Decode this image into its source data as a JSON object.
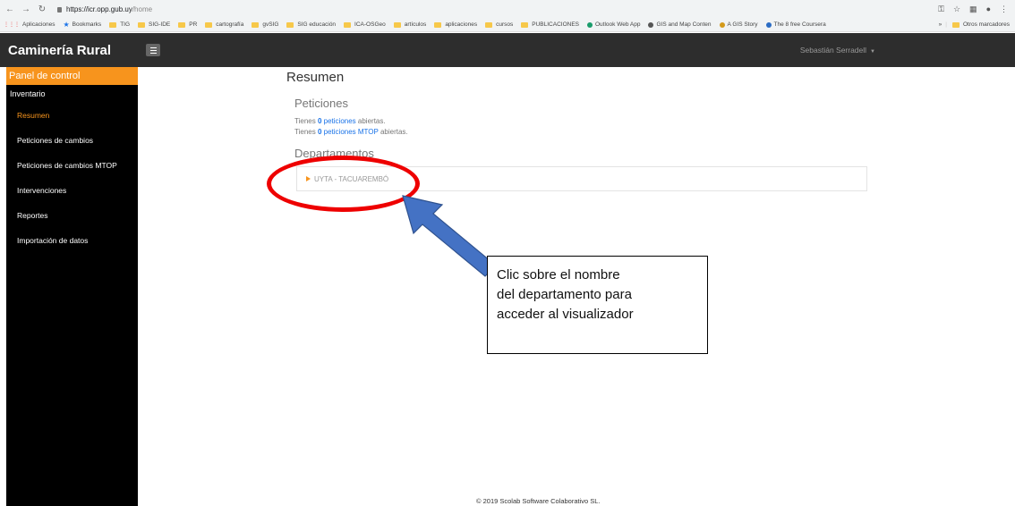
{
  "browser": {
    "url_host": "https://icr.opp.gub.uy",
    "url_path": "/home",
    "bookmarks": [
      {
        "label": "Aplicaciones",
        "kind": "apps"
      },
      {
        "label": "Bookmarks",
        "kind": "star"
      },
      {
        "label": "TIG",
        "kind": "folder"
      },
      {
        "label": "SIG-IDE",
        "kind": "folder"
      },
      {
        "label": "PR",
        "kind": "folder"
      },
      {
        "label": "cartografía",
        "kind": "folder"
      },
      {
        "label": "gvSIG",
        "kind": "folder"
      },
      {
        "label": "SIG educación",
        "kind": "folder"
      },
      {
        "label": "ICA-OSGeo",
        "kind": "folder"
      },
      {
        "label": "artículos",
        "kind": "folder"
      },
      {
        "label": "aplicaciones",
        "kind": "folder"
      },
      {
        "label": "cursos",
        "kind": "folder"
      },
      {
        "label": "PUBLICACIONES",
        "kind": "folder"
      },
      {
        "label": "Outlook Web App",
        "kind": "site"
      },
      {
        "label": "GIS and Map Conten",
        "kind": "site"
      },
      {
        "label": "A GIS Story",
        "kind": "site"
      },
      {
        "label": "The 8 free Coursera",
        "kind": "site"
      }
    ],
    "other_bookmarks": "Otros marcadores",
    "overflow": "»"
  },
  "header": {
    "brand": "Caminería Rural",
    "user": "Sebastián Serradell"
  },
  "sidebar": {
    "panel_title": "Panel de control",
    "group": "Inventario",
    "items": [
      {
        "label": "Resumen",
        "active": true
      },
      {
        "label": "Peticiones de cambios",
        "active": false
      },
      {
        "label": "Peticiones de cambios MTOP",
        "active": false
      },
      {
        "label": "Intervenciones",
        "active": false
      },
      {
        "label": "Reportes",
        "active": false
      },
      {
        "label": "Importación de datos",
        "active": false
      }
    ]
  },
  "main": {
    "title": "Resumen",
    "peticiones_title": "Peticiones",
    "line1": {
      "prefix": "Tienes",
      "count": "0",
      "link": "peticiones",
      "suffix": "abiertas."
    },
    "line2": {
      "prefix": "Tienes",
      "count": "0",
      "link": "peticiones MTOP",
      "suffix": "abiertas."
    },
    "departamentos_title": "Departamentos",
    "department": "UYTA - TACUAREMBÓ",
    "footer": "© 2019 Scolab Software Colaborativo SL."
  },
  "annotation": {
    "callout_text": "Clic sobre el nombre\ndel departamento para\nacceder al visualizador",
    "ellipse_color": "#ee0000",
    "arrow_color": "#4472c4"
  }
}
